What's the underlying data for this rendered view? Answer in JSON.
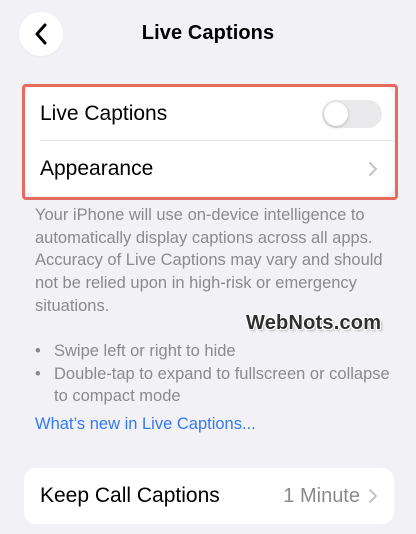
{
  "nav": {
    "title": "Live Captions"
  },
  "main_group": {
    "toggle_row_label": "Live Captions",
    "toggle_state": "off",
    "appearance_row_label": "Appearance"
  },
  "description": "Your iPhone will use on-device intelligence to automatically display captions across all apps. Accuracy of Live Captions may vary and should not be relied upon in high-risk or emergency situations.",
  "bullets": [
    "Swipe left or right to hide",
    "Double-tap to expand to fullscreen or collapse to compact mode"
  ],
  "bullet_symbol": "•",
  "link_text": "What’s new in Live Captions...",
  "watermark": "WebNots.com",
  "call_captions": {
    "label": "Keep Call Captions",
    "value": "1 Minute"
  },
  "colors": {
    "background": "#f2f2f6",
    "accent_link": "#3478f6",
    "highlight_border": "#e46b5e",
    "secondary_text": "#8a8a8e"
  },
  "icons": {
    "back": "chevron-left-icon",
    "disclosure": "chevron-right-icon"
  }
}
